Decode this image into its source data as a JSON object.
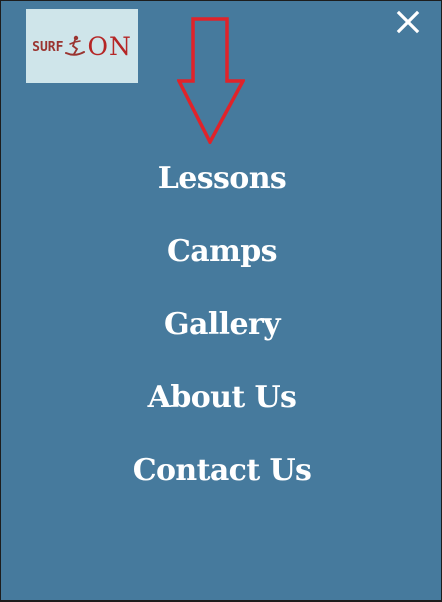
{
  "logo": {
    "surf_text": "SURF",
    "on_text": "ON",
    "background": "#cfe5ea",
    "accent_color": "#b52626"
  },
  "close_icon": "close-icon",
  "annotation": {
    "icon": "down-arrow-icon",
    "color": "#e0232a"
  },
  "menu": {
    "items": [
      {
        "label": "Lessons"
      },
      {
        "label": "Camps"
      },
      {
        "label": "Gallery"
      },
      {
        "label": "About Us"
      },
      {
        "label": "Contact Us"
      }
    ]
  },
  "colors": {
    "panel_background": "#467a9d",
    "text": "#ffffff"
  }
}
